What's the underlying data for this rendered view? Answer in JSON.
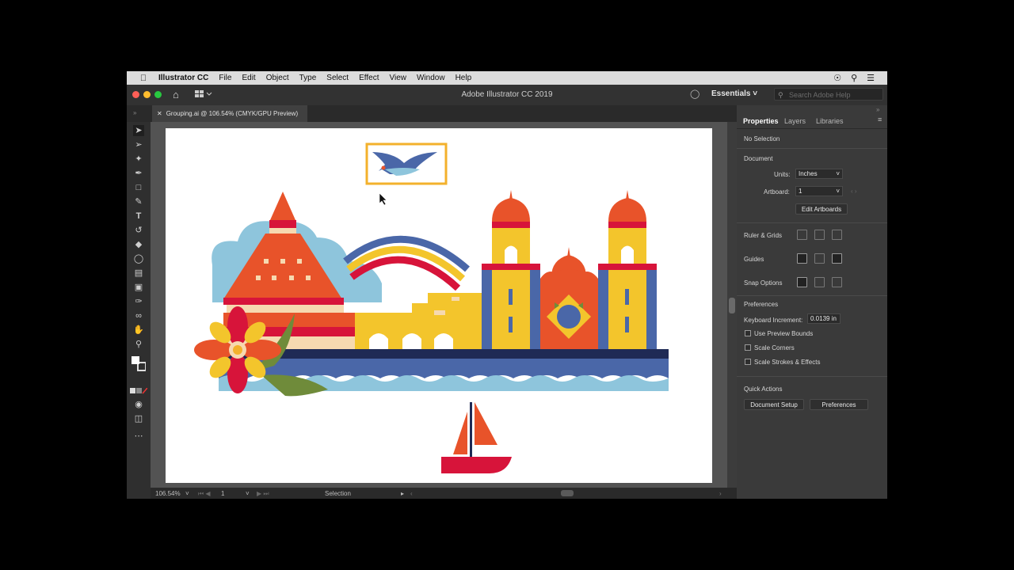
{
  "menubar": {
    "app_name": "Illustrator CC",
    "items": [
      "File",
      "Edit",
      "Object",
      "Type",
      "Select",
      "Effect",
      "View",
      "Window",
      "Help"
    ]
  },
  "appbar": {
    "title": "Adobe Illustrator CC 2019",
    "workspace": "Essentials",
    "search_placeholder": "Search Adobe Help"
  },
  "document_tab": {
    "label": "Grouping.ai @ 106.54% (CMYK/GPU Preview)"
  },
  "statusbar": {
    "zoom": "106.54%",
    "artboard": "1",
    "tool": "Selection"
  },
  "panel": {
    "tabs": [
      "Properties",
      "Layers",
      "Libraries"
    ],
    "no_selection": "No Selection",
    "document_heading": "Document",
    "units_label": "Units:",
    "units_value": "Inches",
    "artboard_label": "Artboard:",
    "artboard_value": "1",
    "edit_artboards": "Edit Artboards",
    "ruler_grids": "Ruler & Grids",
    "guides": "Guides",
    "snap_options": "Snap Options",
    "preferences_heading": "Preferences",
    "keyboard_increment_label": "Keyboard Increment:",
    "keyboard_increment_value": "0.0139 in",
    "use_preview_bounds": "Use Preview Bounds",
    "scale_corners": "Scale Corners",
    "scale_strokes": "Scale Strokes & Effects",
    "quick_actions": "Quick Actions",
    "document_setup": "Document Setup",
    "preferences_button": "Preferences"
  },
  "colors": {
    "orange": "#e8532a",
    "red": "#d7143a",
    "yellow": "#f3c52c",
    "blue": "#4a67a8",
    "navy": "#1f2a55",
    "lightblue": "#8ec5dc",
    "green": "#6f8b3a",
    "peach": "#f6d9b0"
  }
}
